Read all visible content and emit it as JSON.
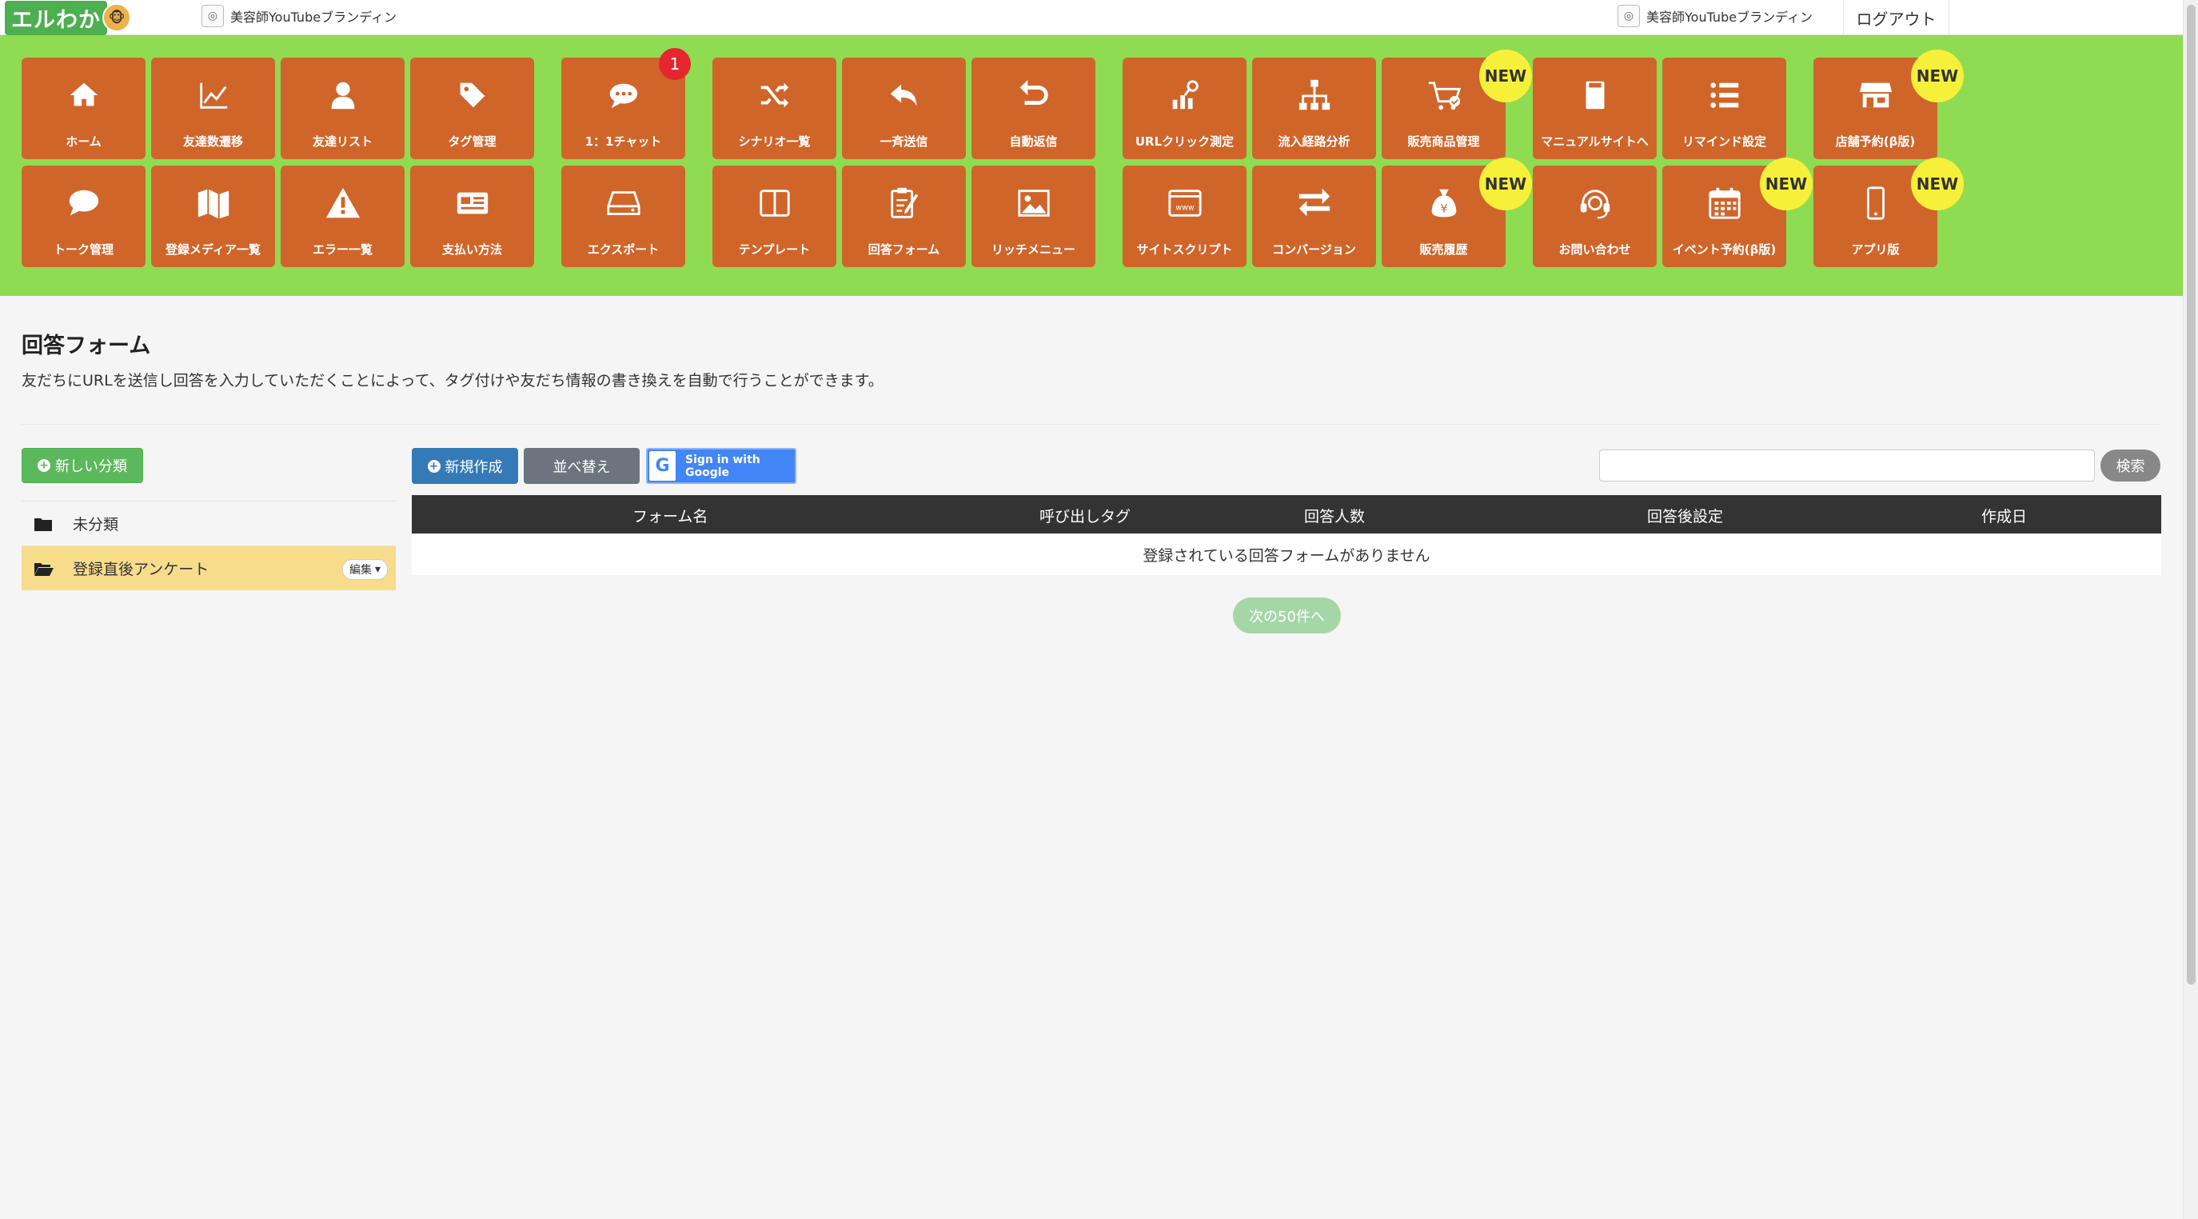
{
  "app": {
    "logo_text": "エルわか",
    "account_name_left": "美容師YouTubeブランディン",
    "account_name_right": "美容師YouTubeブランディン",
    "logout_label": "ログアウト"
  },
  "menu": {
    "tiles": [
      {
        "label": "ホーム",
        "icon": "home-icon"
      },
      {
        "label": "友達数遷移",
        "icon": "line-chart-icon"
      },
      {
        "label": "友達リスト",
        "icon": "user-icon"
      },
      {
        "label": "タグ管理",
        "icon": "tags-icon"
      },
      {
        "label": "1：1チャット",
        "icon": "chat-icon",
        "badge": "1"
      },
      {
        "label": "シナリオ一覧",
        "icon": "shuffle-icon"
      },
      {
        "label": "一斉送信",
        "icon": "reply-icon"
      },
      {
        "label": "自動返信",
        "icon": "return-icon"
      },
      {
        "label": "URLクリック測定",
        "icon": "click-stats-icon"
      },
      {
        "label": "流入経路分析",
        "icon": "sitemap-icon"
      },
      {
        "label": "販売商品管理",
        "icon": "cart-icon",
        "new": "NEW"
      },
      {
        "label": "マニュアルサイトへ",
        "icon": "book-icon"
      },
      {
        "label": "リマインド設定",
        "icon": "list-icon"
      },
      {
        "label": "店舗予約(β版)",
        "icon": "store-icon",
        "new": "NEW"
      },
      {
        "label": "トーク管理",
        "icon": "comment-icon"
      },
      {
        "label": "登録メディア一覧",
        "icon": "map-icon"
      },
      {
        "label": "エラー一覧",
        "icon": "warning-icon"
      },
      {
        "label": "支払い方法",
        "icon": "credit-card-icon"
      },
      {
        "label": "エクスポート",
        "icon": "hdd-icon"
      },
      {
        "label": "テンプレート",
        "icon": "columns-icon"
      },
      {
        "label": "回答フォーム",
        "icon": "clipboard-edit-icon"
      },
      {
        "label": "リッチメニュー",
        "icon": "image-icon"
      },
      {
        "label": "サイトスクリプト",
        "icon": "www-icon"
      },
      {
        "label": "コンバージョン",
        "icon": "exchange-icon"
      },
      {
        "label": "販売履歴",
        "icon": "money-bag-icon",
        "new": "NEW"
      },
      {
        "label": "お問い合わせ",
        "icon": "headset-icon"
      },
      {
        "label": "イベント予約(β版)",
        "icon": "calendar-icon",
        "new": "NEW"
      },
      {
        "label": "アプリ版",
        "icon": "mobile-icon",
        "new": "NEW"
      }
    ]
  },
  "page": {
    "title": "回答フォーム",
    "description": "友だちにURLを送信し回答を入力していただくことによって、タグ付けや友だち情報の書き換えを自動で行うことができます。"
  },
  "sidebar": {
    "new_category_label": "新しい分類",
    "categories": [
      {
        "label": "未分類"
      },
      {
        "label": "登録直後アンケート",
        "edit_label": "編集",
        "active": true
      }
    ]
  },
  "toolbar": {
    "create_label": "新規作成",
    "sort_label": "並べ替え",
    "google_label": "Sign in with Google",
    "search_value": "",
    "search_label": "検索"
  },
  "table": {
    "columns": [
      "フォーム名",
      "呼び出しタグ",
      "回答人数",
      "回答後設定",
      "作成日"
    ],
    "empty_message": "登録されている回答フォームがありません",
    "next_label": "次の50件へ"
  },
  "colors": {
    "menu_background": "#8fdb52",
    "tile": "#d0652a",
    "new_badge": "#f7f03a",
    "count_badge": "#e6262e",
    "active_category": "#f7dc8c"
  }
}
